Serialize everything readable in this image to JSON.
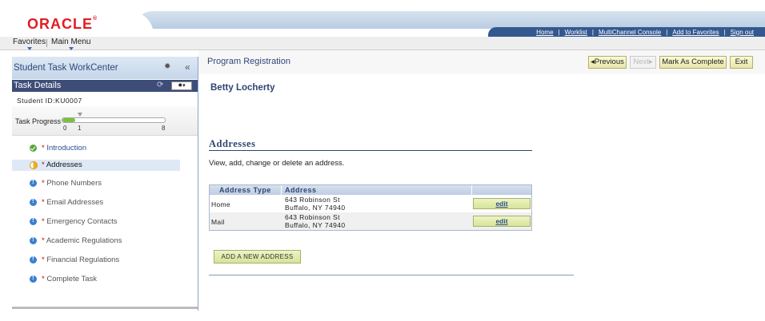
{
  "header": {
    "logo": "ORACLE",
    "links": [
      "Home",
      "Worklist",
      "MultiChannel Console",
      "Add to Favorites",
      "Sign out"
    ]
  },
  "menu": {
    "favorites": "Favorites",
    "main_menu": "Main Menu"
  },
  "left_panel": {
    "title": "Student Task WorkCenter",
    "task_details": "Task Details",
    "student_id": "Student ID:KU0007",
    "progress": {
      "label": "Task Progress",
      "start": "0",
      "current": "1",
      "end": "8",
      "fraction": 0.125
    },
    "steps": [
      {
        "star": "*",
        "label": "Introduction"
      },
      {
        "star": "*",
        "label": "Addresses"
      },
      {
        "star": "*",
        "label": "Phone Numbers"
      },
      {
        "star": "*",
        "label": "Email Addresses"
      },
      {
        "star": "*",
        "label": "Emergency Contacts"
      },
      {
        "star": "*",
        "label": "Academic Regulations"
      },
      {
        "star": "*",
        "label": "Financial Regulations"
      },
      {
        "star": "*",
        "label": "Complete Task"
      }
    ]
  },
  "content": {
    "page_title": "Program Registration",
    "buttons": {
      "previous": "◂Previous",
      "next": "Next▸",
      "mark_complete": "Mark As Complete",
      "exit": "Exit"
    },
    "student_name": "Betty Locherty",
    "section_title": "Addresses",
    "section_desc": "View, add, change or delete an address.",
    "table": {
      "headers": [
        "Address Type",
        "Address"
      ],
      "rows": [
        {
          "type": "Home",
          "line1": "643 Robinson St",
          "line2": "Buffalo, NY 74940",
          "action": "edit"
        },
        {
          "type": "Mail",
          "line1": "643 Robinson St",
          "line2": "Buffalo, NY 74940",
          "action": "edit"
        }
      ]
    },
    "add_button": "ADD A NEW ADDRESS"
  }
}
